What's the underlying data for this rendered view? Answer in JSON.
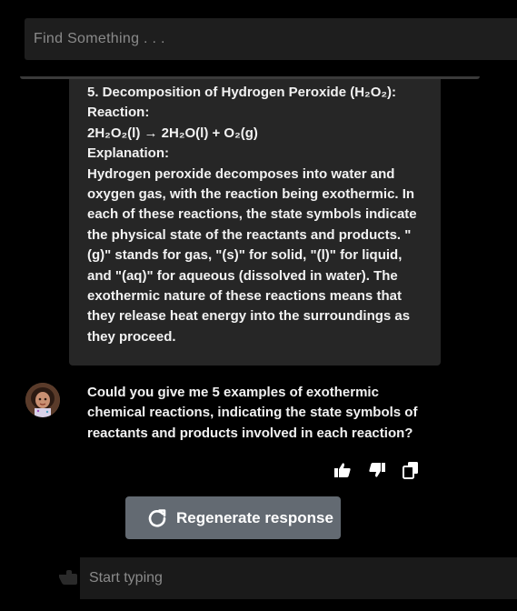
{
  "search": {
    "placeholder": "Find Something . . ."
  },
  "answer": {
    "lines": [
      "5. Decomposition of Hydrogen Peroxide (H₂O₂):",
      "Reaction:",
      "2H₂O₂(l) → 2H₂O(l) + O₂(g)",
      "Explanation:",
      "Hydrogen peroxide decomposes into water and oxygen gas, with the reaction being exothermic. In each of these reactions, the state symbols indicate the physical state of the reactants and products. \"(g)\" stands for gas, \"(s)\" for solid, \"(l)\" for liquid, and \"(aq)\" for aqueous (dissolved in water). The exothermic nature of these reactions means that they release heat energy into the surroundings as they proceed."
    ]
  },
  "user_message": {
    "text": "Could you give me 5 examples of exothermic chemical reactions, indicating the state symbols of reactants and products involved in each reaction?"
  },
  "feedback": {
    "icons": [
      "thumbs-up-icon",
      "thumbs-down-icon",
      "copy-icon"
    ]
  },
  "regenerate": {
    "label": "Regenerate response",
    "icon": "refresh-icon"
  },
  "composer": {
    "placeholder": "Start typing",
    "icon": "hand-pointer-icon"
  },
  "colors": {
    "background": "#000000",
    "card": "#262626",
    "search_bg": "#1e1e1e",
    "button": "#636a72",
    "text": "#f2f2f2",
    "placeholder": "#8a8a8a"
  }
}
